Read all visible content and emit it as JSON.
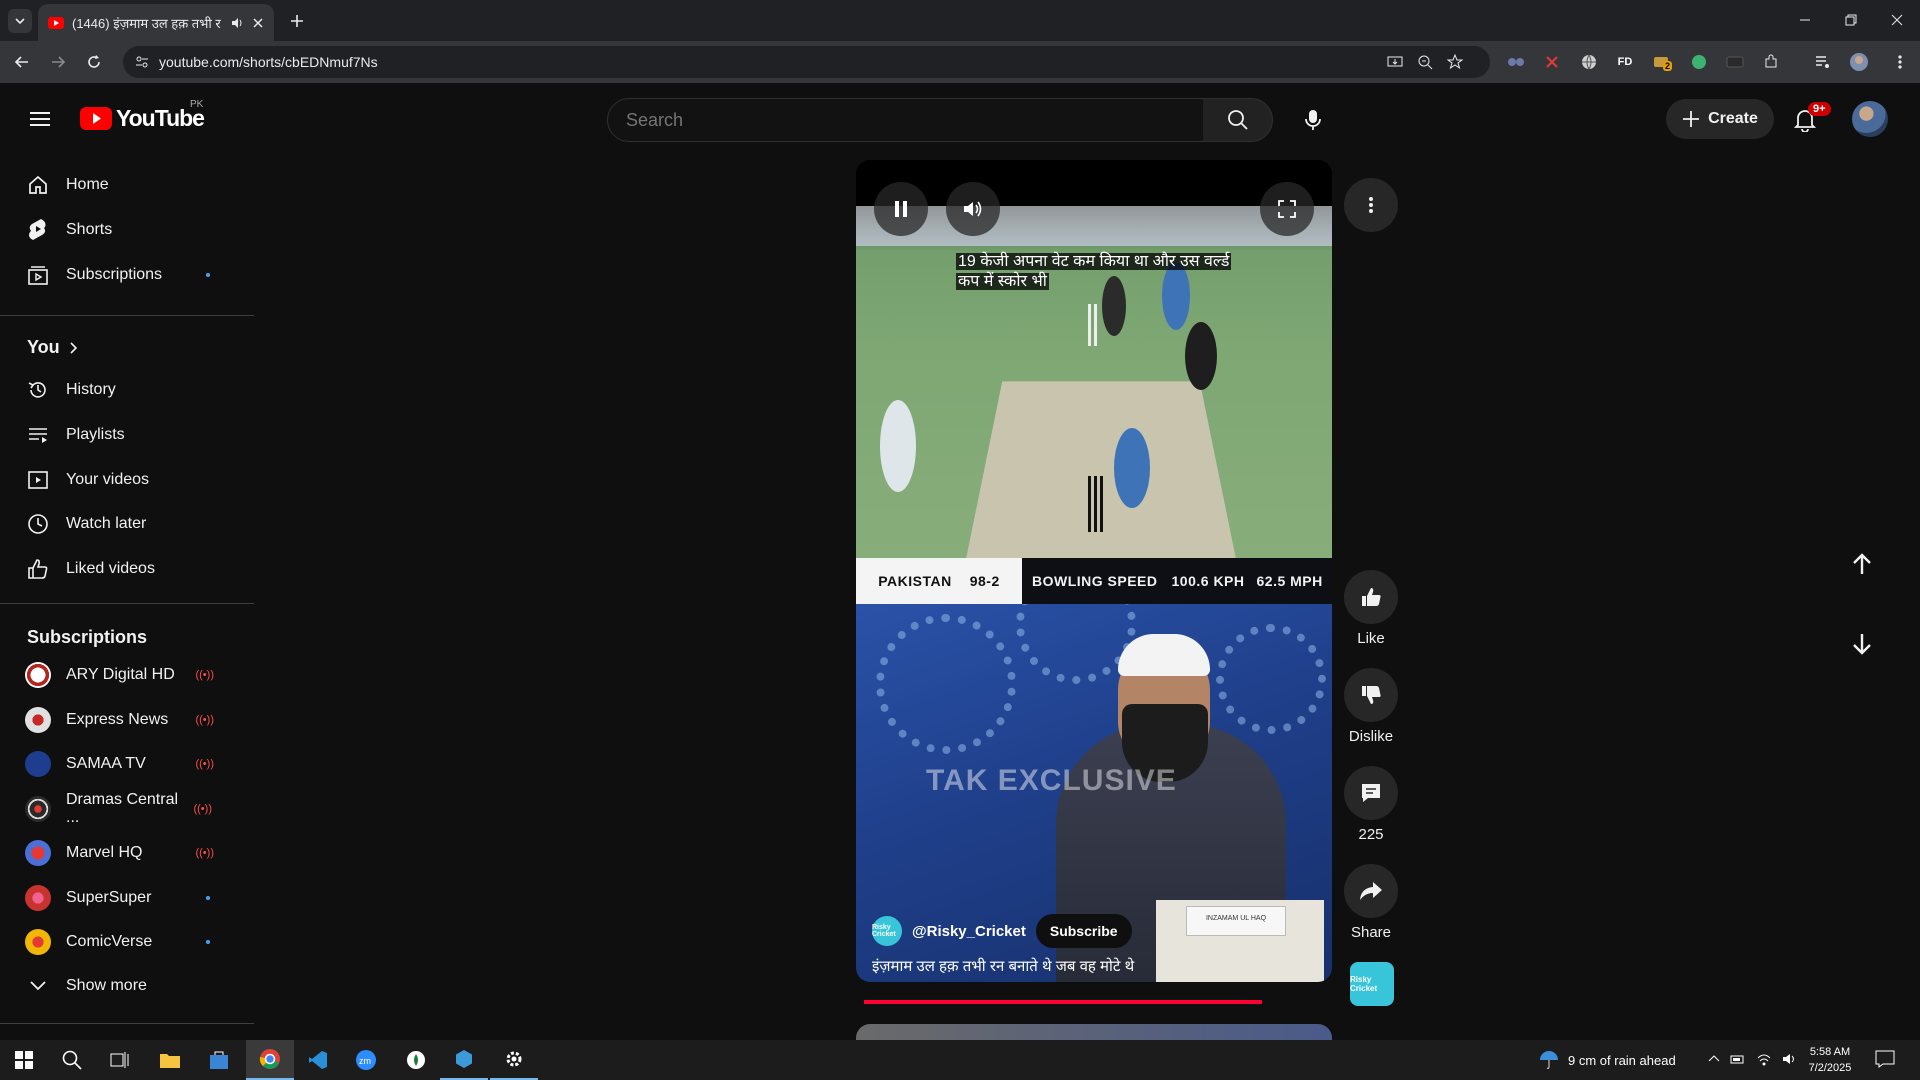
{
  "browser": {
    "tab_title": "(1446) इंज़माम उल हक़ तभी र",
    "url": "youtube.com/shorts/cbEDNmuf7Ns",
    "extensions": [
      "FD"
    ],
    "ext_badge": "2"
  },
  "masthead": {
    "logo_text": "YouTube",
    "country_code": "PK",
    "search_placeholder": "Search",
    "create_label": "Create",
    "notifications_badge": "9+"
  },
  "sidebar": {
    "main": [
      {
        "label": "Home",
        "icon": "home-icon"
      },
      {
        "label": "Shorts",
        "icon": "shorts-icon"
      },
      {
        "label": "Subscriptions",
        "icon": "subscriptions-icon",
        "dot": true
      }
    ],
    "you_heading": "You",
    "you_items": [
      {
        "label": "History",
        "icon": "history-icon"
      },
      {
        "label": "Playlists",
        "icon": "playlists-icon"
      },
      {
        "label": "Your videos",
        "icon": "your-videos-icon"
      },
      {
        "label": "Watch later",
        "icon": "watch-later-icon"
      },
      {
        "label": "Liked videos",
        "icon": "liked-videos-icon"
      }
    ],
    "subscriptions_heading": "Subscriptions",
    "subscriptions": [
      {
        "label": "ARY Digital HD",
        "status": "live",
        "color": "#e8e8e8"
      },
      {
        "label": "Express News",
        "status": "live",
        "color": "#d9d9d9"
      },
      {
        "label": "SAMAA TV",
        "status": "live",
        "color": "#1f3d8f"
      },
      {
        "label": "Dramas Central ...",
        "status": "live",
        "color": "#2b2b2b"
      },
      {
        "label": "Marvel HQ",
        "status": "live",
        "color": "#4a6fd6"
      },
      {
        "label": "SuperSuper",
        "status": "new",
        "color": "#c9332e"
      },
      {
        "label": "ComicVerse",
        "status": "new",
        "color": "#f2b705"
      }
    ],
    "show_more": "Show more"
  },
  "short": {
    "caption_overlay": "19 केजी अपना वेट कम किया था और उस वर्ल्ड कप में स्कोर भी",
    "scoreboard_team": "PAKISTAN",
    "scoreboard_score": "98-2",
    "scoreboard_speed_label": "BOWLING SPEED",
    "scoreboard_kph": "100.6 KPH",
    "scoreboard_mph": "62.5 MPH",
    "watermark": "TAK EXCLUSIVE",
    "podium_label": "INZAMAM UL HAQ",
    "channel_handle": "@Risky_Cricket",
    "channel_thumb_text": "Risky Cricket",
    "subscribe_label": "Subscribe",
    "title": "इंज़माम उल हक़ तभी रन बनाते थे जब वह मोटे थे",
    "progress": 0.85
  },
  "actions": {
    "like_label": "Like",
    "dislike_label": "Dislike",
    "comments_count": "225",
    "share_label": "Share"
  },
  "taskbar": {
    "weather_text": "9 cm of rain ahead",
    "time": "5:58 AM",
    "date": "7/2/2025"
  },
  "colors": {
    "youtube_red": "#ff0033",
    "accent_blue": "#3ea6ff",
    "live_red": "#ff4e45"
  }
}
